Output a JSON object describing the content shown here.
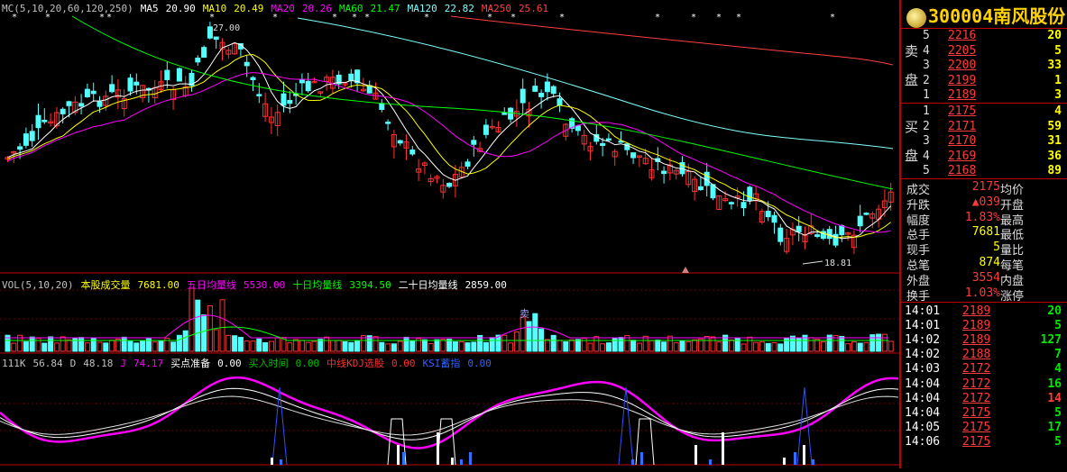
{
  "colors": {
    "up": "#ff3232",
    "down": "#54ffff",
    "ma5": "#ffffff",
    "ma10": "#ffff00",
    "ma20": "#ff00ff",
    "ma60": "#00ff00",
    "ma120": "#7fffff",
    "ma250": "#ff4040",
    "grid": "#8b0000"
  },
  "legend": {
    "main": [
      {
        "text": "MC(5,10,20,60,120,250)",
        "color": "#c0c0c0"
      },
      {
        "text": "MA5",
        "color": "#ffffff"
      },
      {
        "text": "20.90",
        "color": "#ffffff"
      },
      {
        "text": "MA10",
        "color": "#ffff00"
      },
      {
        "text": "20.49",
        "color": "#ffff00"
      },
      {
        "text": "MA20",
        "color": "#ff00ff"
      },
      {
        "text": "20.26",
        "color": "#ff00ff"
      },
      {
        "text": "MA60",
        "color": "#00ff00"
      },
      {
        "text": "21.47",
        "color": "#00ff00"
      },
      {
        "text": "MA120",
        "color": "#7fffff"
      },
      {
        "text": "22.82",
        "color": "#7fffff"
      },
      {
        "text": "MA250",
        "color": "#ff4040"
      },
      {
        "text": "25.61",
        "color": "#ff4040"
      }
    ],
    "vol": [
      {
        "text": "VOL(5,10,20)",
        "color": "#c0c0c0"
      },
      {
        "text": "本股成交量",
        "color": "#ffff00"
      },
      {
        "text": "7681.00",
        "color": "#ffff00"
      },
      {
        "text": "五日均量线",
        "color": "#ff00ff"
      },
      {
        "text": "5530.00",
        "color": "#ff00ff"
      },
      {
        "text": "十日均量线",
        "color": "#00ff00"
      },
      {
        "text": "3394.50",
        "color": "#00ff00"
      },
      {
        "text": "二十日均量线",
        "color": "#ffffff"
      },
      {
        "text": "2859.00",
        "color": "#ffffff"
      }
    ],
    "ind": [
      {
        "text": "111K",
        "color": "#c0c0c0"
      },
      {
        "text": "56.84",
        "color": "#c0c0c0"
      },
      {
        "text": "D",
        "color": "#c0c0c0"
      },
      {
        "text": "48.18",
        "color": "#c0c0c0"
      },
      {
        "text": "J",
        "color": "#ff00ff"
      },
      {
        "text": "74.17",
        "color": "#ff00ff"
      },
      {
        "text": "买点准备",
        "color": "#ffffff"
      },
      {
        "text": "0.00",
        "color": "#ffffff"
      },
      {
        "text": "买入时间",
        "color": "#00c000"
      },
      {
        "text": "0.00",
        "color": "#00c000"
      },
      {
        "text": "中线KDJ选股",
        "color": "#ff3030"
      },
      {
        "text": "0.00",
        "color": "#ff3030"
      },
      {
        "text": "KSI蓄指",
        "color": "#3060ff"
      },
      {
        "text": "0.00",
        "color": "#3060ff"
      }
    ]
  },
  "annotations": {
    "high_label": "27.00",
    "low_label": "18.81",
    "sell_marker": "卖"
  },
  "stock": {
    "code": "300004",
    "name": "南风股份"
  },
  "sell_orders": [
    {
      "level": "5",
      "price": "2216",
      "vol": "20"
    },
    {
      "level": "4",
      "price": "2205",
      "vol": "5"
    },
    {
      "level": "3",
      "price": "2200",
      "vol": "33"
    },
    {
      "level": "2",
      "price": "2199",
      "vol": "1"
    },
    {
      "level": "1",
      "price": "2189",
      "vol": "3"
    }
  ],
  "buy_orders": [
    {
      "level": "1",
      "price": "2175",
      "vol": "4"
    },
    {
      "level": "2",
      "price": "2171",
      "vol": "59"
    },
    {
      "level": "3",
      "price": "2170",
      "vol": "31"
    },
    {
      "level": "4",
      "price": "2169",
      "vol": "36"
    },
    {
      "level": "5",
      "price": "2168",
      "vol": "89"
    }
  ],
  "side_labels": {
    "sell_1": "卖",
    "sell_2": "盘",
    "buy_1": "买",
    "buy_2": "盘"
  },
  "stats": [
    {
      "l1": "成交",
      "v1": "2175",
      "l2": "均价",
      "v2": ""
    },
    {
      "l1": "升跌",
      "v1": "▲039",
      "l2": "开盘",
      "v2": ""
    },
    {
      "l1": "幅度",
      "v1": "1.83%",
      "l2": "最高",
      "v2": ""
    },
    {
      "l1": "总手",
      "v1": "7681",
      "l2": "最低",
      "v2": ""
    },
    {
      "l1": "现手",
      "v1": "5",
      "l2": "量比",
      "v2": ""
    },
    {
      "l1": "总笔",
      "v1": "874",
      "l2": "每笔",
      "v2": ""
    },
    {
      "l1": "外盘",
      "v1": "3554",
      "l2": "内盘",
      "v2": ""
    },
    {
      "l1": "换手",
      "v1": "1.03%",
      "l2": "涨停",
      "v2": ""
    }
  ],
  "ticks": [
    {
      "time": "14:01",
      "price": "2189",
      "vol": "20"
    },
    {
      "time": "14:01",
      "price": "2189",
      "vol": "5"
    },
    {
      "time": "14:02",
      "price": "2189",
      "vol": "127"
    },
    {
      "time": "14:02",
      "price": "2188",
      "vol": "7"
    },
    {
      "time": "14:03",
      "price": "2172",
      "vol": "4"
    },
    {
      "time": "14:04",
      "price": "2172",
      "vol": "16"
    },
    {
      "time": "14:04",
      "price": "2172",
      "vol": "14"
    },
    {
      "time": "14:04",
      "price": "2175",
      "vol": "5"
    },
    {
      "time": "14:05",
      "price": "2175",
      "vol": "17"
    },
    {
      "time": "14:06",
      "price": "2175",
      "vol": "5"
    }
  ],
  "tick_colors": [
    "green",
    "green",
    "green",
    "green",
    "green",
    "green",
    "red",
    "green",
    "green",
    "green"
  ]
}
